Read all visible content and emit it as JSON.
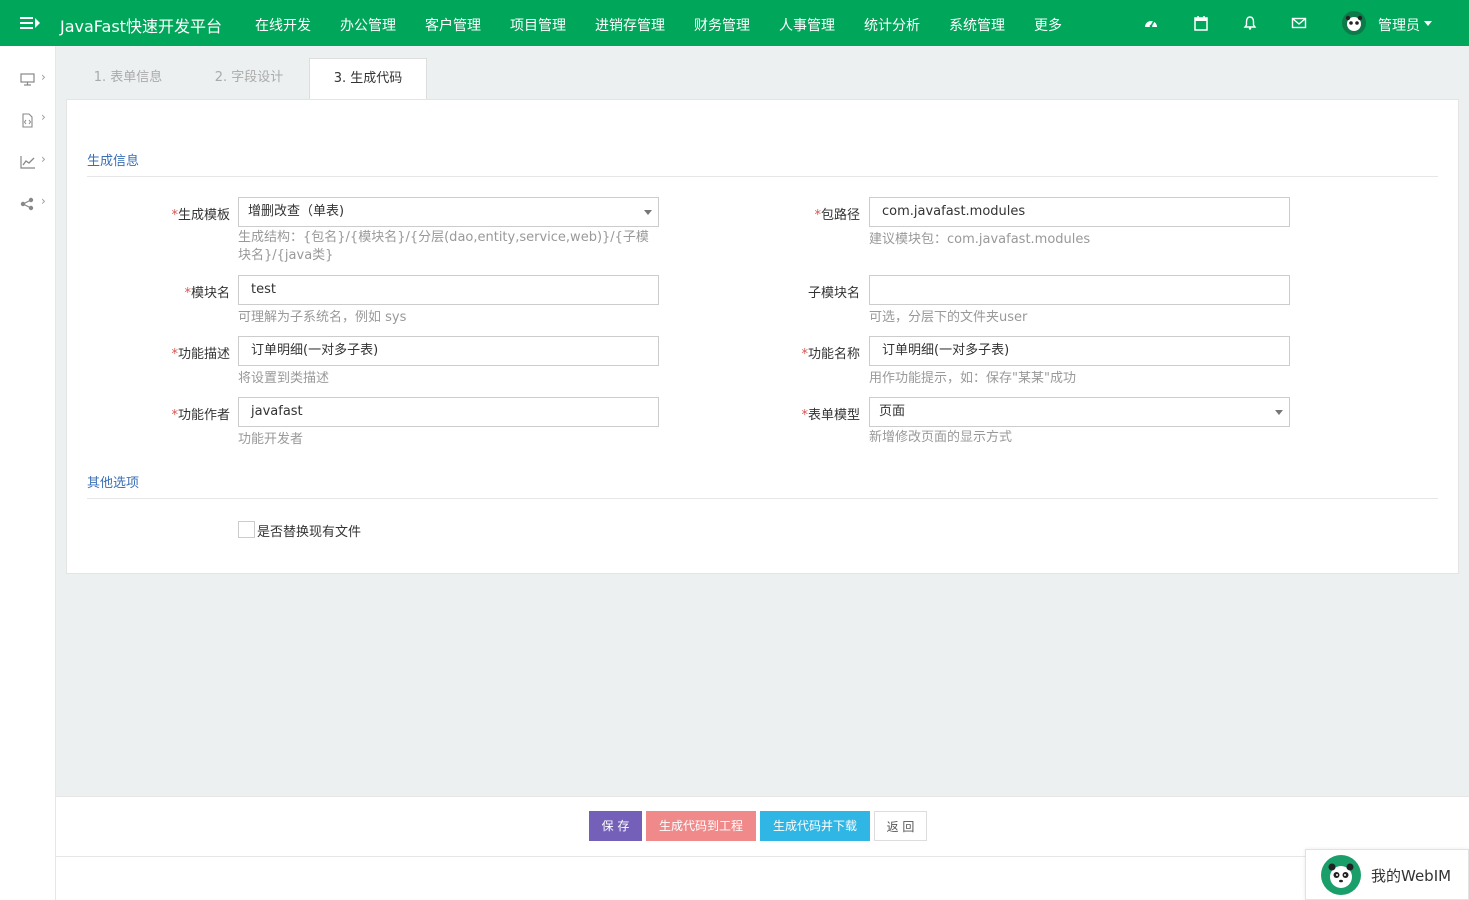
{
  "app": {
    "brand": "JavaFast快速开发平台",
    "nav_menu": [
      "在线开发",
      "办公管理",
      "客户管理",
      "项目管理",
      "进销存管理",
      "财务管理",
      "人事管理",
      "统计分析",
      "系统管理",
      "更多"
    ],
    "nav_icons": [
      "dashboard-icon",
      "calendar-icon",
      "bell-icon",
      "envelope-icon"
    ],
    "user": "管理员",
    "accent_color": "#00a65a"
  },
  "sidebar": {
    "icons": [
      "desktop-icon",
      "code-file-icon",
      "line-chart-icon",
      "share-icon"
    ]
  },
  "tabs": [
    "1. 表单信息",
    "2. 字段设计",
    "3. 生成代码"
  ],
  "active_tab": "3. 生成代码",
  "sections": {
    "generate_info": "生成信息",
    "other_options": "其他选项"
  },
  "form": {
    "template": {
      "label": "生成模板",
      "value": "增删改查（单表)",
      "help": "生成结构：{包名}/{模块名}/{分层(dao,entity,service,web)}/{子模块名}/{java类}"
    },
    "package": {
      "label": "包路径",
      "value": "com.javafast.modules",
      "help": "建议模块包：com.javafast.modules"
    },
    "module": {
      "label": "模块名",
      "value": "test",
      "help": "可理解为子系统名，例如 sys"
    },
    "sub_module": {
      "label": "子模块名",
      "value": "",
      "help": "可选，分层下的文件夹user"
    },
    "func_desc": {
      "label": "功能描述",
      "value": "订单明细(一对多子表)",
      "help": "将设置到类描述"
    },
    "func_name": {
      "label": "功能名称",
      "value": "订单明细(一对多子表)",
      "help": "用作功能提示，如：保存\"某某\"成功"
    },
    "author": {
      "label": "功能作者",
      "value": "javafast",
      "help": "功能开发者"
    },
    "form_model": {
      "label": "表单模型",
      "value": "页面",
      "help": "新增修改页面的显示方式"
    },
    "replace_files": {
      "label": "是否替换现有文件",
      "checked": false
    }
  },
  "buttons": {
    "save": "保 存",
    "gen_project": "生成代码到工程",
    "gen_download": "生成代码并下载",
    "back": "返 回"
  },
  "webim": {
    "label": "我的WebIM"
  }
}
